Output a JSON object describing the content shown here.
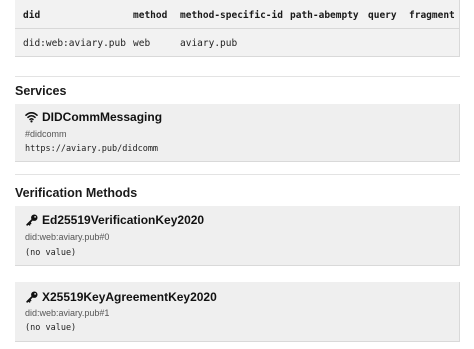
{
  "did_table": {
    "headers": [
      "did",
      "method",
      "method-specific-id",
      "path-abempty",
      "query",
      "fragment"
    ],
    "row": [
      "did:web:aviary.pub",
      "web",
      "aviary.pub",
      "",
      "",
      ""
    ]
  },
  "services": {
    "title": "Services",
    "items": [
      {
        "icon": "wifi-icon",
        "name": "DIDCommMessaging",
        "id": "#didcomm",
        "endpoint": "https://aviary.pub/didcomm"
      }
    ]
  },
  "verification_methods": {
    "title": "Verification Methods",
    "items": [
      {
        "icon": "key-icon",
        "type": "Ed25519VerificationKey2020",
        "id": "did:web:aviary.pub#0",
        "value": "(no value)"
      },
      {
        "icon": "key-icon",
        "type": "X25519KeyAgreementKey2020",
        "id": "did:web:aviary.pub#1",
        "value": "(no value)"
      }
    ]
  }
}
